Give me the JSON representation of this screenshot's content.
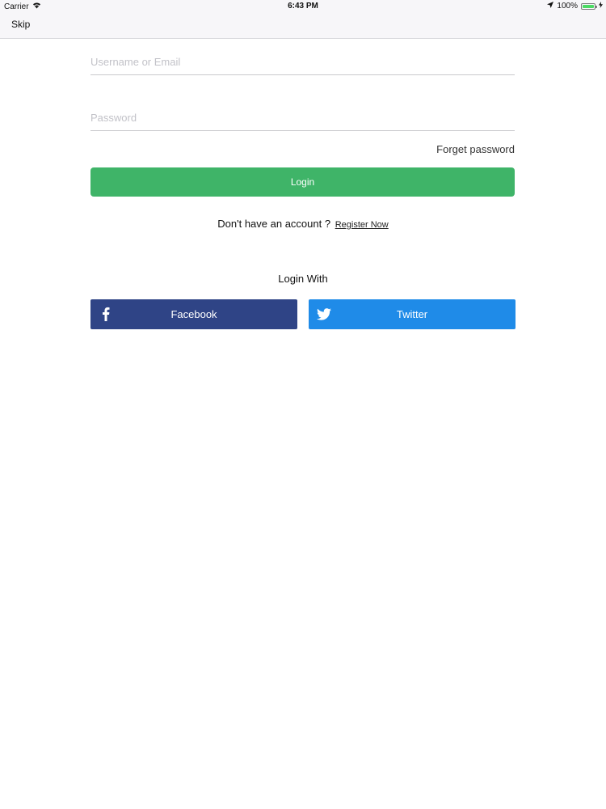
{
  "status_bar": {
    "carrier": "Carrier",
    "time": "6:43 PM",
    "battery": "100%",
    "battery_level": 1.0
  },
  "nav": {
    "skip_label": "Skip"
  },
  "form": {
    "username_placeholder": "Username or Email",
    "password_placeholder": "Password",
    "forget_label": "Forget password",
    "login_label": "Login"
  },
  "register": {
    "prompt": "Don't have an account ?",
    "link_label": "Register Now"
  },
  "social": {
    "heading": "Login With",
    "facebook_label": "Facebook",
    "twitter_label": "Twitter"
  },
  "colors": {
    "login_green": "#3fb468",
    "facebook_blue": "#2f4486",
    "twitter_blue": "#1f8be8",
    "battery_green": "#4cd964"
  },
  "icons": {
    "facebook": "facebook-icon",
    "twitter": "twitter-icon",
    "wifi": "wifi-icon",
    "location": "location-arrow-icon",
    "battery": "battery-icon",
    "charging": "charging-bolt-icon"
  }
}
